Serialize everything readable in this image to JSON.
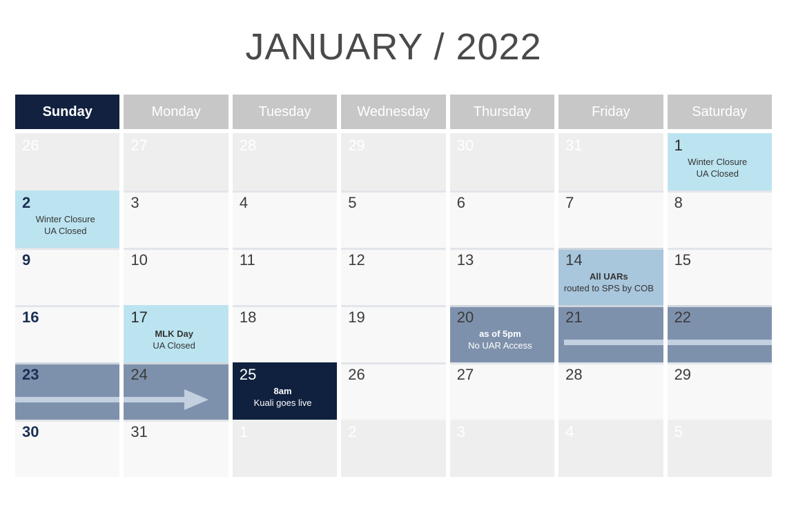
{
  "title": "JANUARY / 2022",
  "weekdays": [
    {
      "label": "Sunday"
    },
    {
      "label": "Monday"
    },
    {
      "label": "Tuesday"
    },
    {
      "label": "Wednesday"
    },
    {
      "label": "Thursday"
    },
    {
      "label": "Friday"
    },
    {
      "label": "Saturday"
    }
  ],
  "colors": {
    "navy": "#10213f",
    "header_grey": "#c7c7c7",
    "light_blue": "#bce4f0",
    "medium_blue": "#a8c6dc",
    "slate": "#7e91ac",
    "bar": "#c3d0e0",
    "cell_bg": "#f8f8f8",
    "muted_bg": "#eeeeee",
    "title_text": "#4a4a4a"
  },
  "weeks": [
    [
      {
        "day": "26",
        "style": "muted",
        "note": []
      },
      {
        "day": "27",
        "style": "muted",
        "note": []
      },
      {
        "day": "28",
        "style": "muted",
        "note": []
      },
      {
        "day": "29",
        "style": "muted",
        "note": []
      },
      {
        "day": "30",
        "style": "muted",
        "note": []
      },
      {
        "day": "31",
        "style": "muted",
        "note": []
      },
      {
        "day": "1",
        "style": "lightblue",
        "note": [
          "Winter Closure",
          "UA Closed"
        ]
      }
    ],
    [
      {
        "day": "2",
        "style": "lightblue",
        "note": [
          "Winter Closure",
          "UA Closed"
        ]
      },
      {
        "day": "3",
        "style": "plain",
        "note": []
      },
      {
        "day": "4",
        "style": "plain",
        "note": []
      },
      {
        "day": "5",
        "style": "plain",
        "note": []
      },
      {
        "day": "6",
        "style": "plain",
        "note": []
      },
      {
        "day": "7",
        "style": "plain",
        "note": []
      },
      {
        "day": "8",
        "style": "plain",
        "note": []
      }
    ],
    [
      {
        "day": "9",
        "style": "plain",
        "note": []
      },
      {
        "day": "10",
        "style": "plain",
        "note": []
      },
      {
        "day": "11",
        "style": "plain",
        "note": []
      },
      {
        "day": "12",
        "style": "plain",
        "note": []
      },
      {
        "day": "13",
        "style": "plain",
        "note": []
      },
      {
        "day": "14",
        "style": "medblue",
        "note": [
          "All UARs",
          "routed to SPS by COB"
        ],
        "bold_lines": [
          0
        ]
      },
      {
        "day": "15",
        "style": "plain",
        "note": []
      }
    ],
    [
      {
        "day": "16",
        "style": "plain",
        "note": []
      },
      {
        "day": "17",
        "style": "lightblue",
        "note": [
          "MLK Day",
          "UA Closed"
        ],
        "bold_lines": [
          0
        ]
      },
      {
        "day": "18",
        "style": "plain",
        "note": []
      },
      {
        "day": "19",
        "style": "plain",
        "note": []
      },
      {
        "day": "20",
        "style": "slate",
        "note": [
          "as of 5pm",
          "No UAR Access"
        ],
        "bold_lines": [
          0
        ]
      },
      {
        "day": "21",
        "style": "slate",
        "note": [],
        "bar": "start"
      },
      {
        "day": "22",
        "style": "slate",
        "note": [],
        "bar": "mid"
      }
    ],
    [
      {
        "day": "23",
        "style": "slate",
        "note": [],
        "bar": "mid"
      },
      {
        "day": "24",
        "style": "slate",
        "note": [],
        "bar": "arrow"
      },
      {
        "day": "25",
        "style": "navy",
        "note": [
          "8am",
          "Kuali goes live"
        ],
        "bold_lines": [
          0
        ]
      },
      {
        "day": "26",
        "style": "plain",
        "note": []
      },
      {
        "day": "27",
        "style": "plain",
        "note": []
      },
      {
        "day": "28",
        "style": "plain",
        "note": []
      },
      {
        "day": "29",
        "style": "plain",
        "note": []
      }
    ],
    [
      {
        "day": "30",
        "style": "plain",
        "note": []
      },
      {
        "day": "31",
        "style": "plain",
        "note": []
      },
      {
        "day": "1",
        "style": "muted",
        "note": []
      },
      {
        "day": "2",
        "style": "muted",
        "note": []
      },
      {
        "day": "3",
        "style": "muted",
        "note": []
      },
      {
        "day": "4",
        "style": "muted",
        "note": []
      },
      {
        "day": "5",
        "style": "muted",
        "note": []
      }
    ]
  ]
}
